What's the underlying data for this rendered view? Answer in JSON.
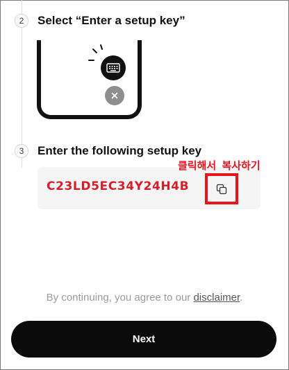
{
  "steps": [
    {
      "number": "2",
      "title": "Select “Enter a setup key”"
    },
    {
      "number": "3",
      "title": "Enter the following setup key"
    }
  ],
  "setup_key": {
    "value": "C23LD5EC34Y24H4B",
    "color": "#d2202a"
  },
  "annotation": {
    "text": "클릭해서 복사하기",
    "color": "#e8141c"
  },
  "disclaimer": {
    "prefix": "By continuing, you agree to our ",
    "link": "disclaimer",
    "suffix": "."
  },
  "next_button": {
    "label": "Next"
  },
  "icons": {
    "keyboard": "keyboard-icon",
    "close": "close-icon",
    "copy": "copy-icon"
  }
}
